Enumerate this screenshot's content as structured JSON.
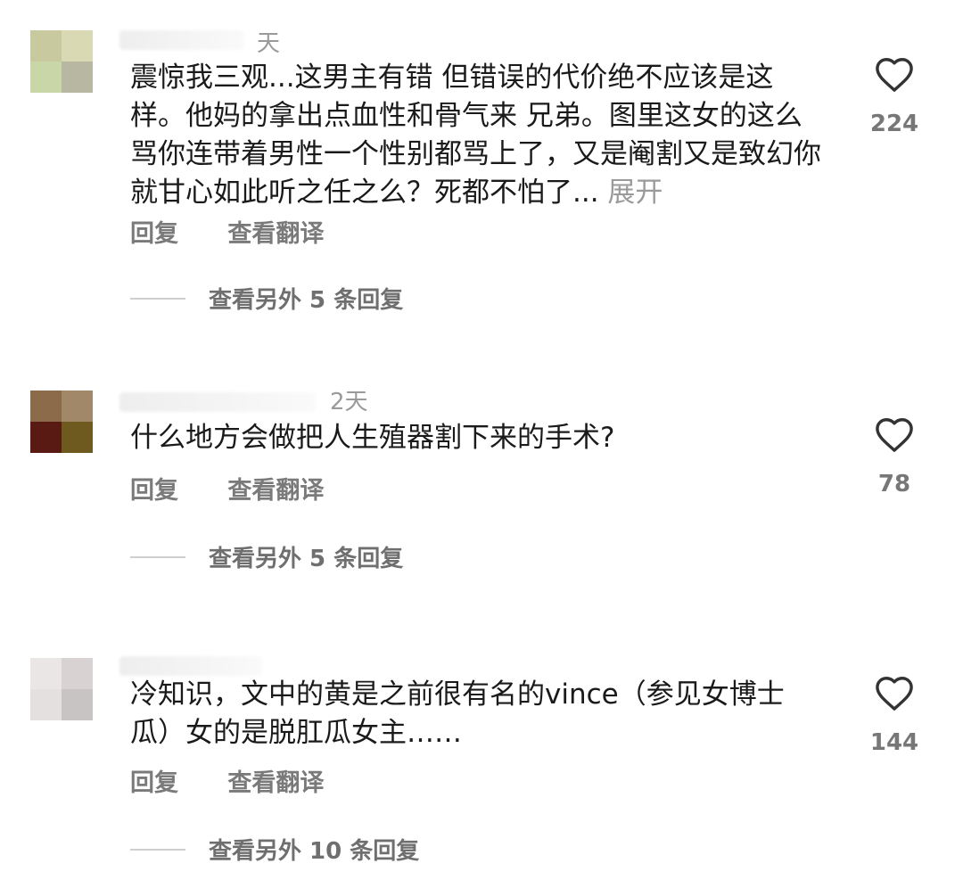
{
  "comments": [
    {
      "time": "天",
      "text": "震惊我三观...这男主有错 但错误的代价绝不应该是这样。他妈的拿出点血性和骨气来 兄弟。图里这女的这么骂你连带着男性一个性别都骂上了，又是阉割又是致幻你就甘心如此听之任之么？死都不怕了...",
      "expand_label": "展开",
      "reply_label": "回复",
      "translate_label": "查看翻译",
      "more_replies": "查看另外 5 条回复",
      "likes": "224"
    },
    {
      "time": "2天",
      "text": "什么地方会做把人生殖器割下来的手术?",
      "reply_label": "回复",
      "translate_label": "查看翻译",
      "more_replies": "查看另外 5 条回复",
      "likes": "78"
    },
    {
      "time": "",
      "text": "冷知识，文中的黄是之前很有名的vince（参见女博士瓜）女的是脱肛瓜女主……",
      "reply_label": "回复",
      "translate_label": "查看翻译",
      "more_replies": "查看另外 10 条回复",
      "likes": "144"
    }
  ],
  "icons": {
    "like": "heart-outline-icon"
  },
  "colors": {
    "text": "#1a1a1a",
    "muted": "#9a9a9a",
    "action": "#7a7a7a"
  }
}
